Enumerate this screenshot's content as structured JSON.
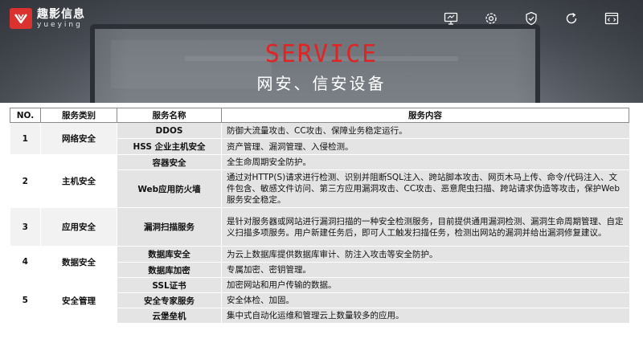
{
  "brand": {
    "name_cn": "趣影信息",
    "name_en": "yueying",
    "accent": "#d9322f"
  },
  "nav_icons": [
    "monitor-icon",
    "settings-gear-icon",
    "shield-check-icon",
    "refresh-icon",
    "code-window-icon"
  ],
  "hero": {
    "title": "SERVICE",
    "subtitle": "网安、信安设备",
    "title_color": "#e02424"
  },
  "table": {
    "headers": {
      "no": "NO.",
      "category": "服务类别",
      "name": "服务名称",
      "content": "服务内容"
    },
    "groups": [
      {
        "no": "1",
        "category": "网络安全",
        "items": [
          {
            "name": "DDOS",
            "content": "防御大流量攻击、CC攻击、保障业务稳定运行。"
          },
          {
            "name": "HSS 企业主机安全",
            "content": "资产管理、漏洞管理、入侵检测。"
          }
        ]
      },
      {
        "no": "2",
        "category": "主机安全",
        "items": [
          {
            "name": "容器安全",
            "content": "全生命周期安全防护。"
          },
          {
            "name": "Web应用防火墙",
            "content": "通过对HTTP(S)请求进行检测、识别并阻断SQL注入、跨站脚本攻击、网页木马上传、命令/代码注入、文件包含、敏感文件访问、第三方应用漏洞攻击、CC攻击、恶意爬虫扫描、跨站请求伪造等攻击，保护Web服务安全稳定。"
          }
        ]
      },
      {
        "no": "3",
        "category": "应用安全",
        "items": [
          {
            "name": "漏洞扫描服务",
            "content": "是针对服务器或网站进行漏洞扫描的一种安全检测服务，目前提供通用漏洞检测、漏洞生命周期管理、自定义扫描多项服务。用户新建任务后，即可人工触发扫描任务，检测出网站的漏洞并给出漏洞修复建议。"
          }
        ]
      },
      {
        "no": "4",
        "category": "数据安全",
        "items": [
          {
            "name": "数据库安全",
            "content": "为云上数据库提供数据库审计、防注入攻击等安全防护。"
          },
          {
            "name": "数据库加密",
            "content": "专属加密、密钥管理。"
          },
          {
            "name": "SSL证书",
            "content": "加密网站和用户传输的数据。"
          }
        ]
      },
      {
        "no": "5",
        "category": "安全管理",
        "items": [
          {
            "name": "安全专家服务",
            "content": "安全体检、加固。"
          },
          {
            "name": "云堡垒机",
            "content": "集中式自动化运维和管理云上数量较多的应用。"
          }
        ]
      }
    ]
  }
}
